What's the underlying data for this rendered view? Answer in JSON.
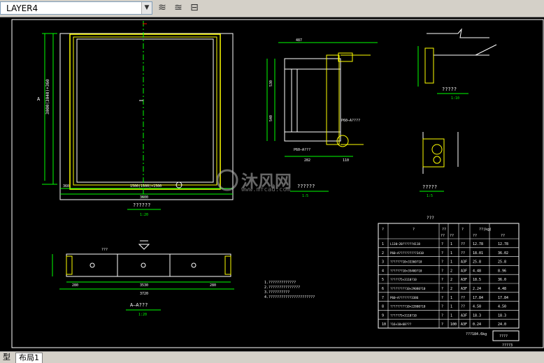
{
  "toolbar": {
    "layer_name": "LAYER4",
    "icons": [
      "layer-states-icon",
      "layer-previous-icon",
      "layer-isolate-icon"
    ]
  },
  "drawing": {
    "front_title": "??????",
    "front_scale": "1:20",
    "top_dim_overall": "3000(3040)+360",
    "bottom_dim_overall": "1500(1500)+1500",
    "bottom_left_dim": "360",
    "bottom_dim_total": "3600",
    "section_dim_left": "487",
    "section_dim_top": "130×20×??",
    "section_dims_vertical": [
      "150",
      "530",
      "540",
      "450"
    ],
    "section_label_1": "P60—A????",
    "section_label_2": "P60—A???",
    "section_bottom_dims": [
      "282",
      "110"
    ],
    "section_title": "??????",
    "section_scale": "1:5",
    "detail1_title": "?????",
    "detail1_scale": "1:10",
    "detail2_title": "?????",
    "detail2_scale": "1:5",
    "plan_title": "A—A???",
    "plan_scale": "1:20",
    "plan_dim_inner": "3530",
    "plan_dim_total": "3720",
    "plan_dim_left": "280",
    "plan_dim_right": "280",
    "plan_label": "???",
    "notes": [
      "1.?????????????",
      "2.???????????????",
      "3.??????????",
      "4.??????????????????????"
    ],
    "watermark": "沐风网",
    "watermark_url": "www.mfcad.com",
    "bom_title": "???",
    "bom_headers": [
      "?",
      "?",
      "??",
      "?",
      "??(kg)"
    ],
    "bom_subheaders": [
      "??",
      "??",
      "??",
      "??"
    ],
    "bom_rows": [
      [
        "1",
        "L130—20??????4118",
        "?",
        "1",
        "??",
        "12.78",
        "12.78"
      ],
      [
        "2",
        "P60—A??????????3410",
        "?",
        "1",
        "??",
        "18.01",
        "36.02"
      ],
      [
        "3",
        "???????10×33360?10",
        "?",
        "1",
        "A3F",
        "25.8",
        "25.8"
      ],
      [
        "4",
        "???????10×35400?10",
        "?",
        "2",
        "A3F",
        "4.48",
        "8.96"
      ],
      [
        "5",
        "?????75×3110?10",
        "?",
        "2",
        "A3F",
        "18.5",
        "36.0"
      ],
      [
        "6",
        "?????????10×29080?10",
        "?",
        "2",
        "A3F",
        "2.24",
        "4.48"
      ],
      [
        "7",
        "P60—A???????3386",
        "?",
        "1",
        "??",
        "17.84",
        "17.84"
      ],
      [
        "8",
        "?????????10×22800?10",
        "?",
        "1",
        "??",
        "4.50",
        "4.50"
      ],
      [
        "9",
        "?????75×3110?10",
        "?",
        "1",
        "A3F",
        "18.3",
        "18.3"
      ],
      [
        "10",
        "?16×10×68???",
        "?",
        "100",
        "A3F",
        "0.24",
        "24.0"
      ]
    ],
    "bom_total": "???184.6kg",
    "bom_corner": "????",
    "bom_footer": "????3"
  },
  "tabs": {
    "model": "型",
    "layout1": "布局1"
  },
  "ucs_label": "X"
}
